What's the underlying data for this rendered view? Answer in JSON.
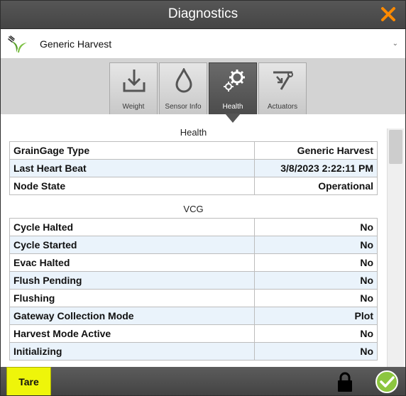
{
  "window": {
    "title": "Diagnostics"
  },
  "device": {
    "name": "Generic Harvest"
  },
  "tabs": [
    {
      "label": "Weight",
      "icon": "download-icon",
      "active": false
    },
    {
      "label": "Sensor Info",
      "icon": "droplet-icon",
      "active": false
    },
    {
      "label": "Health",
      "icon": "gears-icon",
      "active": true
    },
    {
      "label": "Actuators",
      "icon": "actuator-icon",
      "active": false
    }
  ],
  "health": {
    "title": "Health",
    "rows": [
      {
        "label": "GrainGage Type",
        "value": "Generic Harvest"
      },
      {
        "label": "Last Heart Beat",
        "value": "3/8/2023 2:22:11 PM"
      },
      {
        "label": "Node State",
        "value": "Operational"
      }
    ]
  },
  "vcg": {
    "title": "VCG",
    "rows": [
      {
        "label": "Cycle Halted",
        "value": "No"
      },
      {
        "label": "Cycle Started",
        "value": "No"
      },
      {
        "label": "Evac Halted",
        "value": "No"
      },
      {
        "label": "Flush Pending",
        "value": "No"
      },
      {
        "label": "Flushing",
        "value": "No"
      },
      {
        "label": "Gateway Collection Mode",
        "value": "Plot"
      },
      {
        "label": "Harvest Mode Active",
        "value": "No"
      },
      {
        "label": "Initializing",
        "value": "No"
      }
    ]
  },
  "bottom": {
    "tare_label": "Tare"
  },
  "colors": {
    "accent_close": "#ff8a00",
    "tare_bg": "#eef50a",
    "ok_green": "#8cc63f",
    "row_alt": "#eaf3fb"
  }
}
